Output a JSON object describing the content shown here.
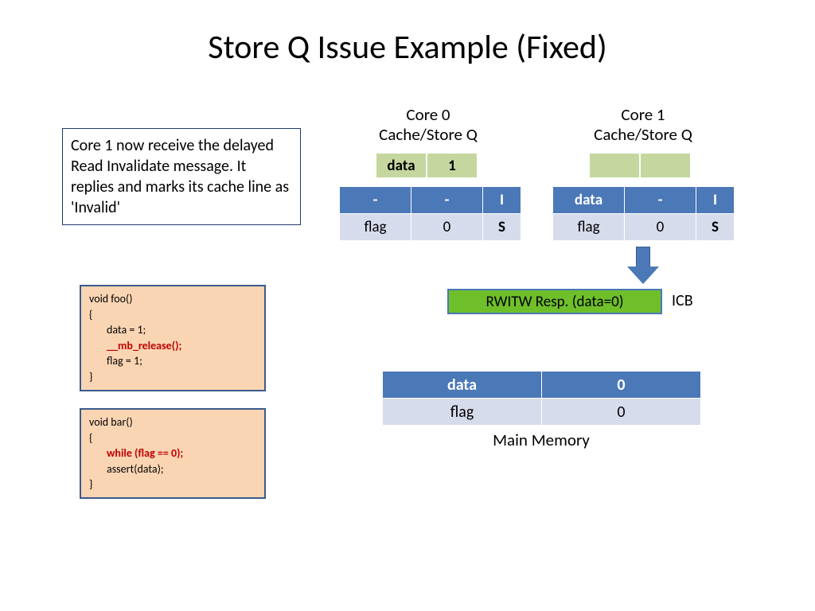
{
  "title": "Store Q Issue Example (Fixed)",
  "note": "Core 1 now receive the delayed Read Invalidate message. It replies and marks its cache line as 'Invalid'",
  "core0": {
    "label": "Core 0\nCache/Store Q",
    "storeq": [
      "data",
      "1"
    ],
    "cache": [
      {
        "c1": "-",
        "c2": "-",
        "c3": "I",
        "hdr": true
      },
      {
        "c1": "flag",
        "c2": "0",
        "c3": "S",
        "hdr": false
      }
    ]
  },
  "core1": {
    "label": "Core 1\nCache/Store Q",
    "storeq": [
      "",
      ""
    ],
    "cache": [
      {
        "c1": "data",
        "c2": "-",
        "c3": "I",
        "hdr": true,
        "red": [
          "c1",
          "c3"
        ]
      },
      {
        "c1": "flag",
        "c2": "0",
        "c3": "S",
        "hdr": false
      }
    ]
  },
  "resp": "RWITW Resp. (data=0)",
  "icb": "ICB",
  "memory": {
    "rows": [
      {
        "c1": "data",
        "c2": "0",
        "hdr": true
      },
      {
        "c1": "flag",
        "c2": "0",
        "hdr": false
      }
    ],
    "label": "Main Memory"
  },
  "code_foo": {
    "sig": "void foo()",
    "open": "{",
    "l1": "data = 1;",
    "l2": "__mb_release();",
    "l3": "flag = 1;",
    "close": "}"
  },
  "code_bar": {
    "sig": "void bar()",
    "open": "{",
    "l1": "while (flag == 0);",
    "l2": "assert(data);",
    "close": "}"
  }
}
